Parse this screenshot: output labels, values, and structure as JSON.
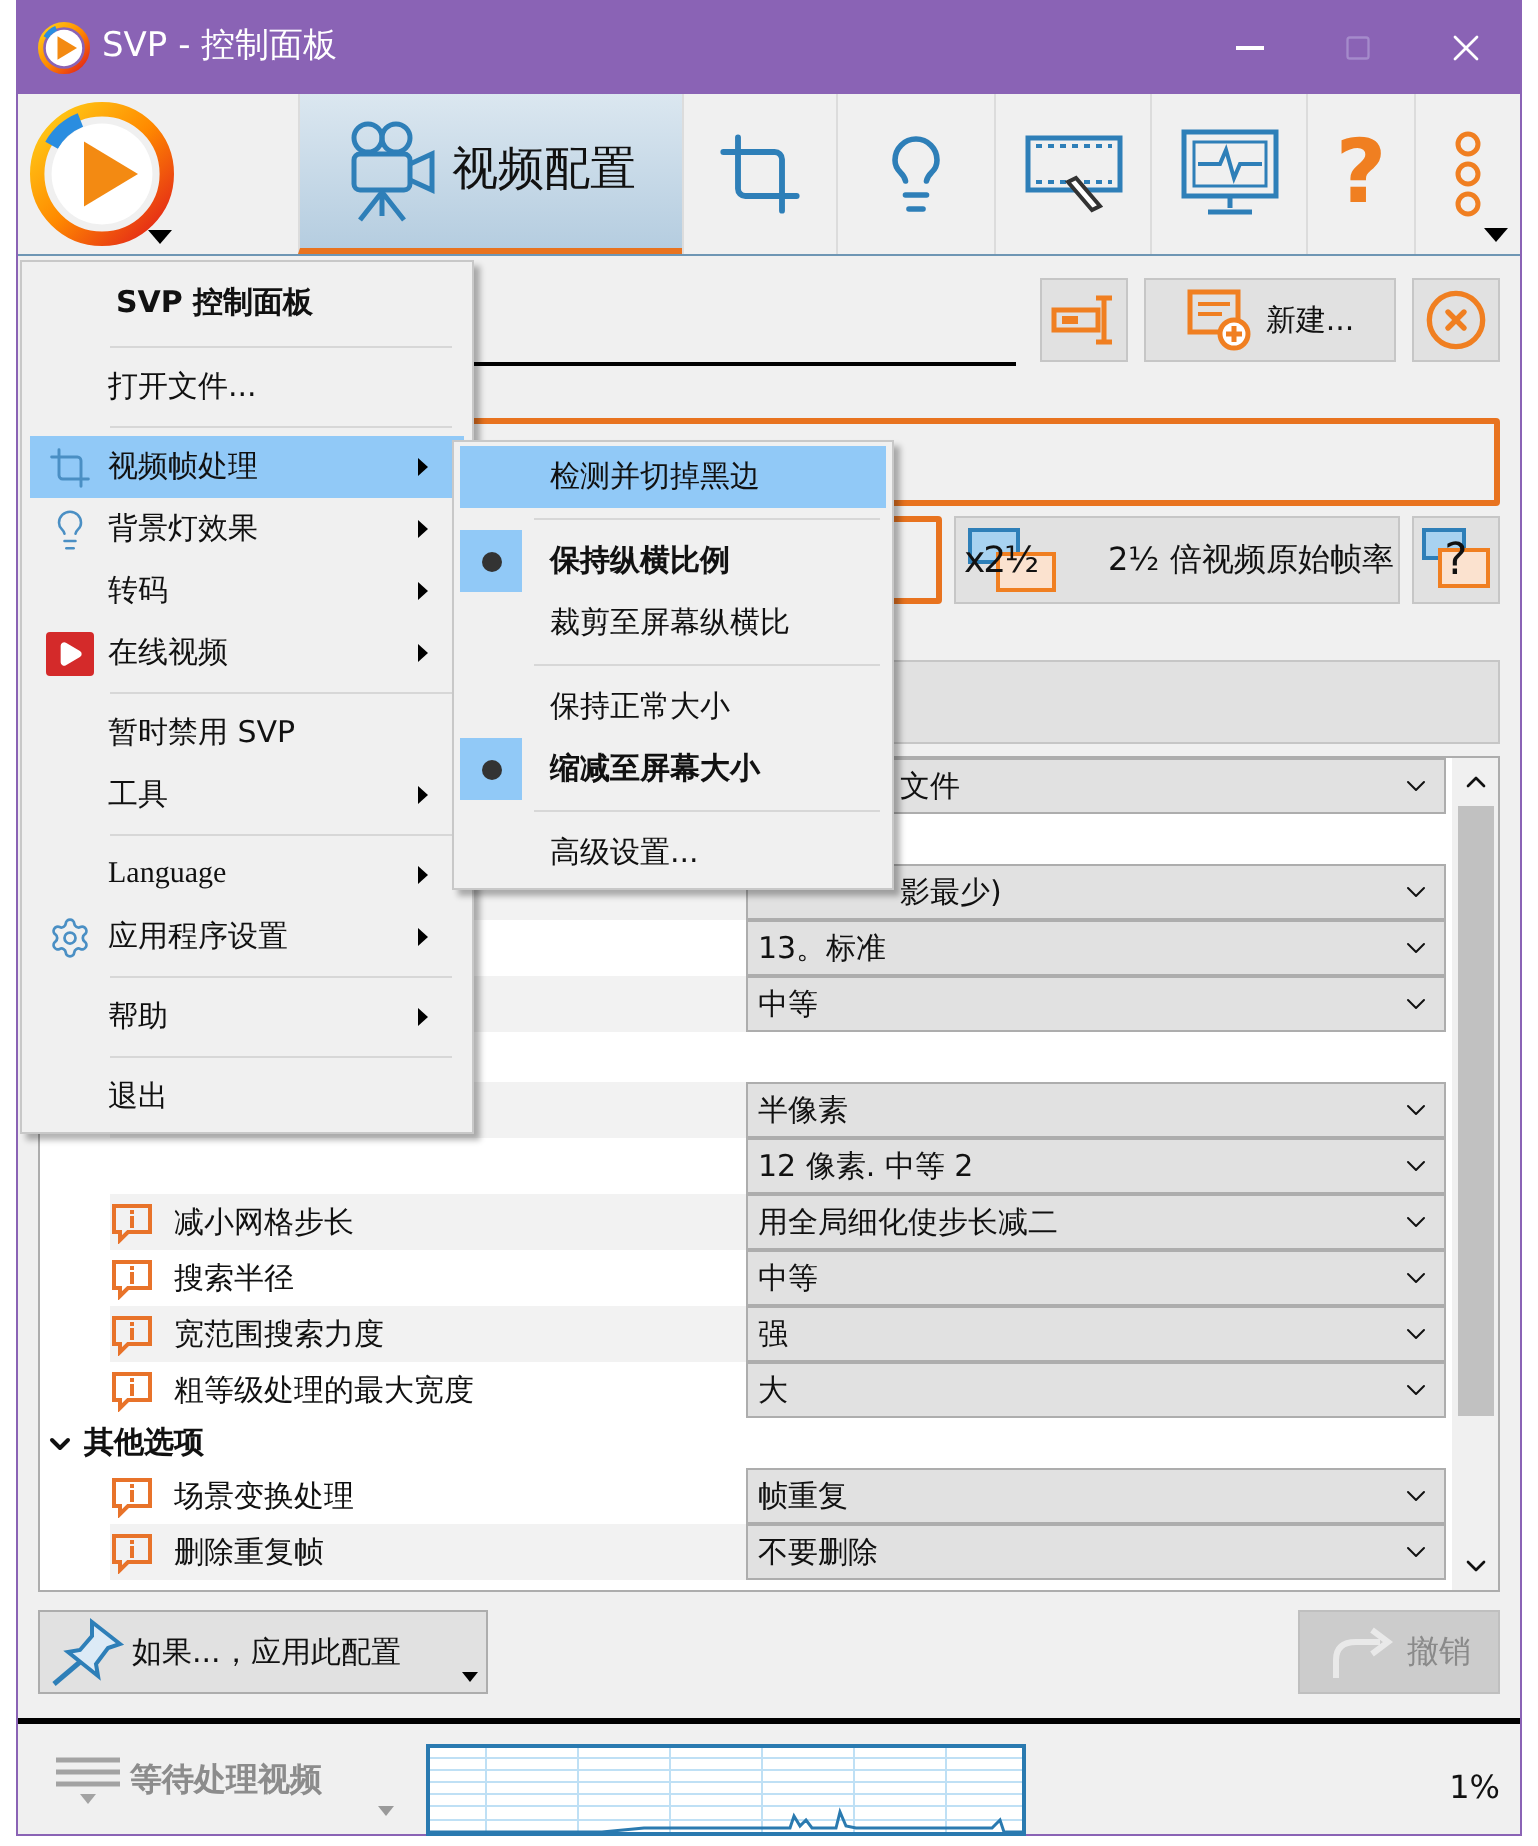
{
  "window": {
    "title": "SVP - 控制面板"
  },
  "toolbar": {
    "tabs": [
      {
        "kind": "camera",
        "label": "视频配置",
        "selected": true
      },
      {
        "kind": "crop",
        "selected": false
      },
      {
        "kind": "bulb",
        "selected": false
      },
      {
        "kind": "film",
        "selected": false
      },
      {
        "kind": "monitor",
        "selected": false
      },
      {
        "kind": "help",
        "label": "?",
        "selected": false
      },
      {
        "kind": "more",
        "selected": false
      }
    ]
  },
  "profile_buttons": [
    {
      "kind": "rename"
    },
    {
      "kind": "new",
      "label": "新建..."
    },
    {
      "kind": "delete"
    }
  ],
  "frame_rate": {
    "badge": "x2½",
    "label": "2½ 倍视频原始帧率",
    "help": "?"
  },
  "properties": [
    {
      "kind": "partial",
      "value": "文件"
    },
    {
      "kind": "group"
    },
    {
      "kind": "partial",
      "value": "影最少)"
    },
    {
      "kind": "row",
      "value": "13。标准"
    },
    {
      "kind": "row",
      "value": "中等"
    },
    {
      "kind": "group"
    },
    {
      "kind": "row",
      "value": "半像素"
    },
    {
      "kind": "row",
      "value": "12 像素. 中等 2"
    },
    {
      "kind": "row",
      "label": "减小网格步长",
      "value": "用全局细化使步长减二"
    },
    {
      "kind": "row",
      "label": "搜索半径",
      "value": "中等"
    },
    {
      "kind": "row",
      "label": "宽范围搜索力度",
      "value": "强"
    },
    {
      "kind": "row",
      "label": "粗等级处理的最大宽度",
      "value": "大"
    },
    {
      "kind": "group",
      "label": "其他选项",
      "expanded": true
    },
    {
      "kind": "row",
      "label": "场景变换处理",
      "value": "帧重复"
    },
    {
      "kind": "row",
      "label": "删除重复帧",
      "value": "不要删除"
    }
  ],
  "apply_button": {
    "label": "如果...，应用此配置"
  },
  "undo_button": {
    "label": "撤销",
    "disabled": true
  },
  "status_bar": {
    "text": "等待处理视频",
    "percent": "1%"
  },
  "main_menu": {
    "items": [
      {
        "kind": "header",
        "label": "SVP 控制面板"
      },
      {
        "kind": "separator"
      },
      {
        "kind": "item",
        "label": "打开文件...",
        "submenu": false,
        "selected": false
      },
      {
        "kind": "separator"
      },
      {
        "kind": "item",
        "label": "视频帧处理",
        "submenu": true,
        "selected": true
      },
      {
        "kind": "item",
        "label": "背景灯效果",
        "submenu": true,
        "selected": false
      },
      {
        "kind": "item",
        "label": "转码",
        "submenu": true,
        "selected": false
      },
      {
        "kind": "item",
        "label": "在线视频",
        "submenu": true,
        "selected": false
      },
      {
        "kind": "separator"
      },
      {
        "kind": "item",
        "label": "暂时禁用 SVP",
        "submenu": false,
        "selected": false
      },
      {
        "kind": "item",
        "label": "工具",
        "submenu": true,
        "selected": false
      },
      {
        "kind": "separator"
      },
      {
        "kind": "item",
        "label": "Language",
        "latin": true,
        "submenu": true,
        "selected": false
      },
      {
        "kind": "item",
        "label": "应用程序设置",
        "submenu": true,
        "selected": false
      },
      {
        "kind": "separator"
      },
      {
        "kind": "item",
        "label": "帮助",
        "submenu": true,
        "selected": false
      },
      {
        "kind": "separator"
      },
      {
        "kind": "item",
        "label": "退出",
        "submenu": false,
        "selected": false
      }
    ]
  },
  "submenu": {
    "items": [
      {
        "kind": "item",
        "label": "检测并切掉黑边",
        "selected": true
      },
      {
        "kind": "separator"
      },
      {
        "kind": "radio",
        "label": "保持纵横比例",
        "checked": true
      },
      {
        "kind": "radio",
        "label": "裁剪至屏幕纵横比",
        "checked": false
      },
      {
        "kind": "separator"
      },
      {
        "kind": "radio",
        "label": "保持正常大小",
        "checked": false
      },
      {
        "kind": "radio",
        "label": "缩减至屏幕大小",
        "checked": true
      },
      {
        "kind": "separator"
      },
      {
        "kind": "item",
        "label": "高级设置...",
        "selected": false
      }
    ]
  }
}
